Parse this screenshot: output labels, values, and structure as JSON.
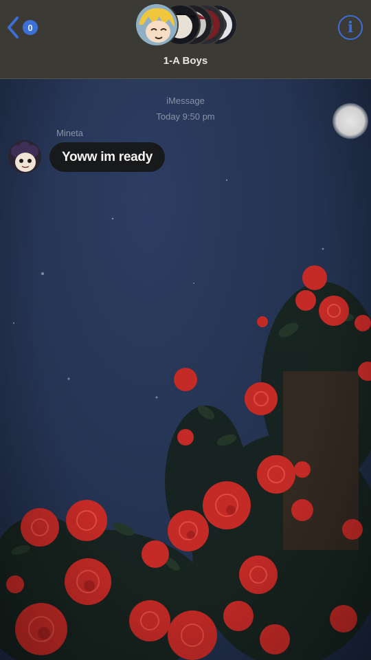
{
  "header": {
    "back_count": "0",
    "group_name": "1-A Boys",
    "info_label": "i"
  },
  "thread": {
    "service": "iMessage",
    "timestamp": "Today 9:50 pm",
    "messages": [
      {
        "sender": "Mineta",
        "text": "Yoww im ready"
      }
    ]
  },
  "icons": {
    "back": "chevron-left-icon",
    "info": "info-icon",
    "assistive_touch": "assistive-touch-icon"
  },
  "colors": {
    "accent": "#3d6ed6",
    "header_bg": "#3b3a35",
    "bubble_bg": "#18191b",
    "wallpaper_sky": "#23324f",
    "rose": "#c9302c"
  }
}
